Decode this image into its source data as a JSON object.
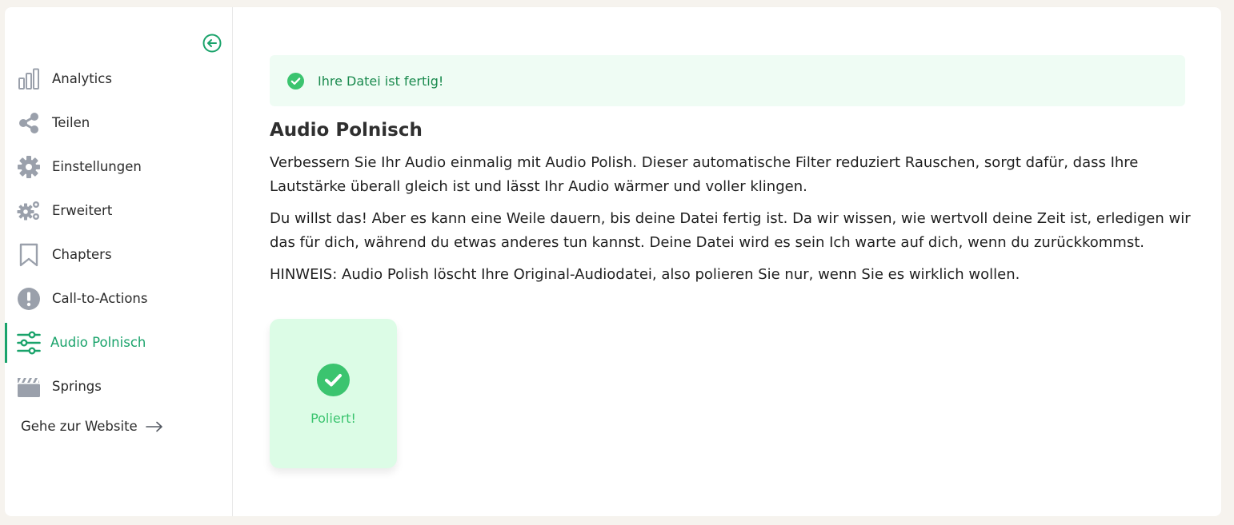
{
  "sidebar": {
    "items": [
      {
        "label": "Analytics",
        "icon": "bar-chart-icon"
      },
      {
        "label": "Teilen",
        "icon": "share-icon"
      },
      {
        "label": "Einstellungen",
        "icon": "gear-icon"
      },
      {
        "label": "Erweitert",
        "icon": "gears-icon"
      },
      {
        "label": "Chapters",
        "icon": "bookmark-icon"
      },
      {
        "label": "Call-to-Actions",
        "icon": "exclamation-circle-icon"
      },
      {
        "label": "Audio Polnisch",
        "icon": "sliders-icon",
        "active": true
      },
      {
        "label": "Springs",
        "icon": "clapperboard-icon"
      }
    ],
    "website_link": "Gehe zur Website"
  },
  "alert": {
    "text": "Ihre Datei ist fertig!"
  },
  "main": {
    "title": "Audio Polnisch",
    "paragraphs": [
      "Verbessern Sie Ihr Audio einmalig mit Audio Polish. Dieser automatische Filter reduziert Rauschen, sorgt dafür, dass Ihre Lautstärke überall gleich ist und lässt Ihr Audio wärmer und voller klingen.",
      "Du willst das! Aber es kann eine Weile dauern, bis deine Datei fertig ist. Da wir wissen, wie wertvoll deine Zeit ist, erledigen wir das für dich, während du etwas anderes tun kannst. Deine Datei wird es sein Ich warte auf dich, wenn du zurückkommst.",
      "HINWEIS: Audio Polish löscht Ihre Original-Audiodatei, also polieren Sie nur, wenn Sie es wirklich wollen."
    ],
    "polish_card": {
      "label": "Poliert!"
    }
  },
  "colors": {
    "accent": "#1aa36b",
    "alert_bg": "#effcf4",
    "card_bg": "#dcfce6",
    "success_green": "#3bc46f",
    "icon_gray": "#9aa0ab"
  }
}
